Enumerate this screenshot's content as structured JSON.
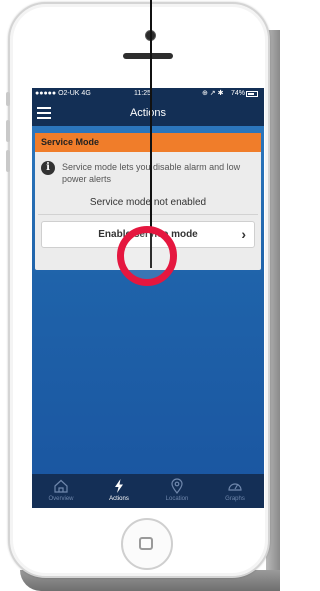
{
  "status_bar": {
    "carrier": "●●●●● O2-UK 4G",
    "time": "11:25",
    "indicators": "⊕ ↗ ✱",
    "battery": "74%",
    "battery_level": 0.74
  },
  "nav": {
    "title": "Actions",
    "menu_icon": "hamburger-icon"
  },
  "card": {
    "header": "Service Mode",
    "info_icon": "info-icon",
    "info_glyph": "i",
    "description": "Service mode lets you disable alarm and low power alerts",
    "status": "Service mode not enabled",
    "button_label": "Enable service mode",
    "button_chevron": "›"
  },
  "tabs": [
    {
      "label": "Overview",
      "icon": "house-icon",
      "active": false
    },
    {
      "label": "Actions",
      "icon": "lightning-icon",
      "active": true
    },
    {
      "label": "Location",
      "icon": "map-pin-icon",
      "active": false
    },
    {
      "label": "Graphs",
      "icon": "gauge-icon",
      "active": false
    }
  ],
  "colors": {
    "nav_bg": "#132f55",
    "card_header": "#f07d2a",
    "screen_blue": "#2f7bc1",
    "highlight_ring": "#e5173f"
  }
}
